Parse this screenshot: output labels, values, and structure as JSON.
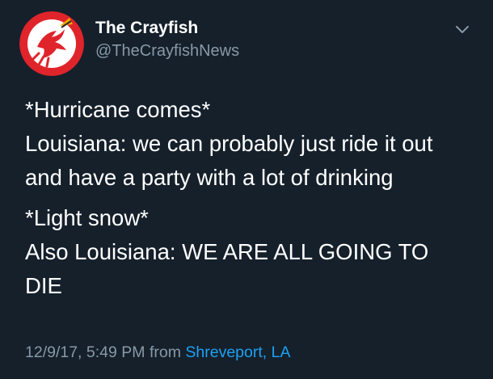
{
  "tweet": {
    "author": {
      "display_name": "The Crayfish",
      "handle": "@TheCrayfishNews",
      "avatar_icon": "crayfish-logo"
    },
    "menu_icon": "chevron-down-icon",
    "body": {
      "paragraph1": [
        "*Hurricane comes*",
        "Louisiana: we can probably just ride it out",
        "and have a party with a lot of drinking"
      ],
      "paragraph2": [
        "*Light snow*",
        "Also Louisiana: WE ARE ALL GOING TO",
        "DIE"
      ]
    },
    "timestamp": "12/9/17, 5:49 PM",
    "from_label": "from",
    "location": "Shreveport, LA"
  },
  "colors": {
    "background": "#15202b",
    "text": "#ffffff",
    "secondary": "#8899a6",
    "link": "#1da1f2",
    "logo_red": "#e0242b"
  }
}
